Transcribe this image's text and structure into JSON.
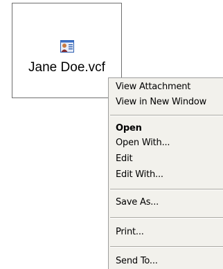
{
  "attachment": {
    "file_name": "Jane Doe.vcf",
    "icon": "vcard-contact-icon"
  },
  "context_menu": {
    "items": [
      {
        "label": "View Attachment"
      },
      {
        "label": "View in New Window"
      },
      {
        "label": "Open",
        "bold": true
      },
      {
        "label": "Open With..."
      },
      {
        "label": "Edit"
      },
      {
        "label": "Edit With..."
      },
      {
        "label": "Save As..."
      },
      {
        "label": "Print..."
      },
      {
        "label": "Send To..."
      }
    ]
  },
  "colors": {
    "menu_background": "#f2f1ec",
    "separator": "#a9a8a1"
  }
}
